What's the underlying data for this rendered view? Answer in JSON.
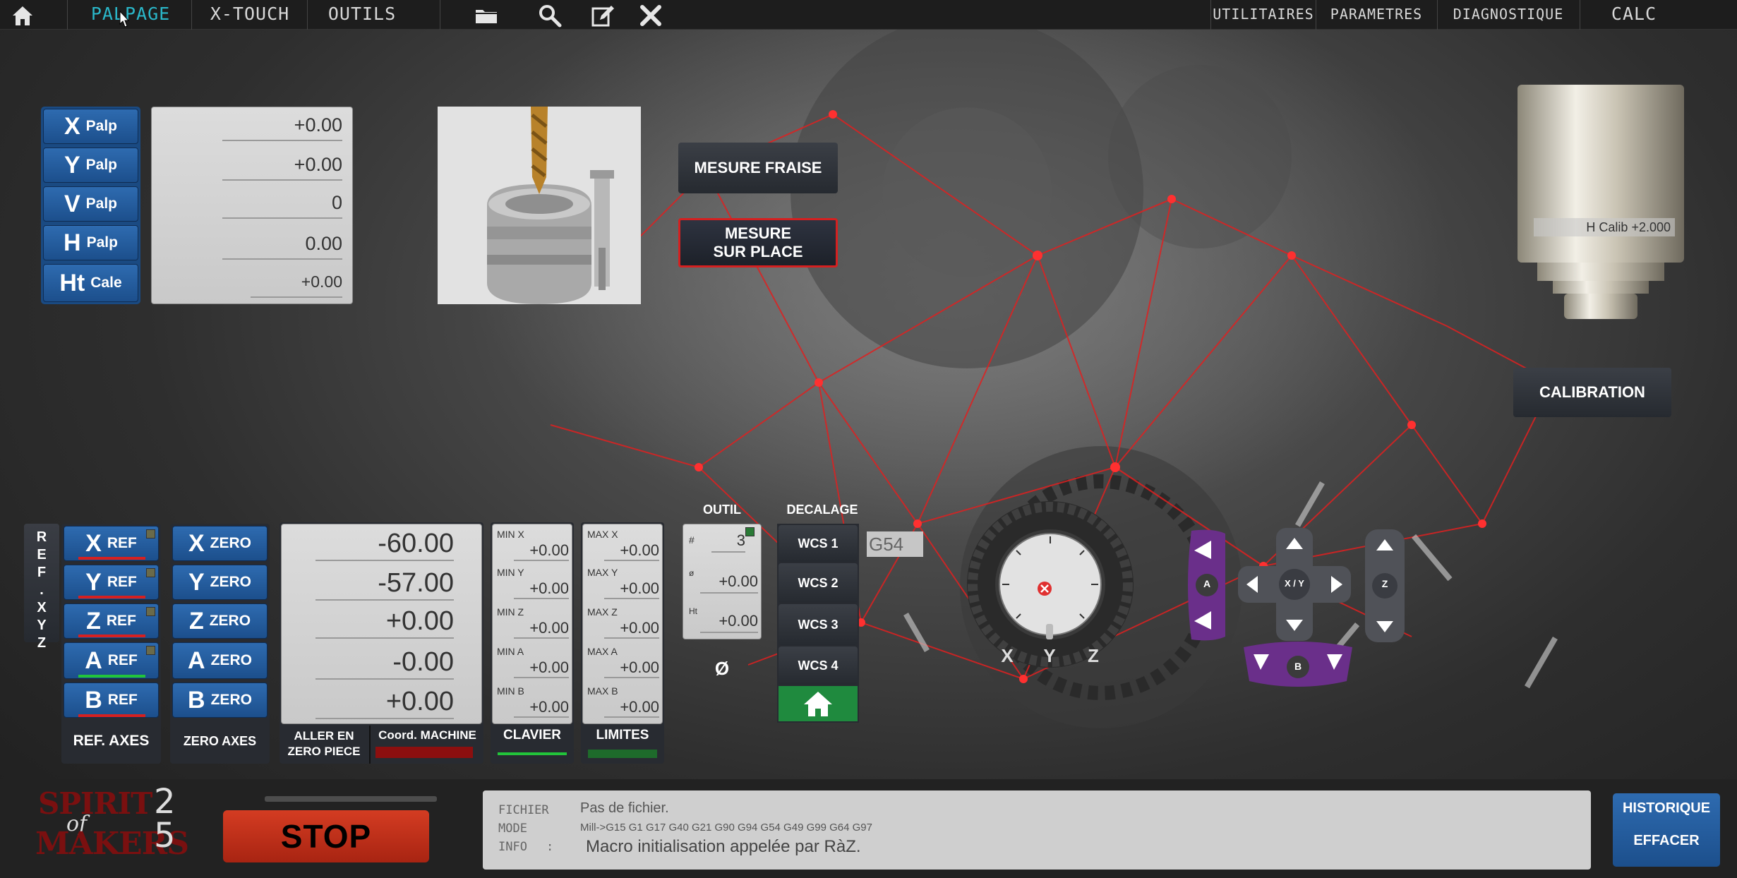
{
  "menu": {
    "tabs": [
      "PALPAGE",
      "X-TOUCH",
      "OUTILS"
    ],
    "right": [
      "UTILITAIRES",
      "PARAMETRES",
      "DIAGNOSTIQUE",
      "CALC"
    ]
  },
  "palp": {
    "rows": [
      {
        "big": "X",
        "small": "Palp",
        "value": "+0.00"
      },
      {
        "big": "Y",
        "small": "Palp",
        "value": "+0.00"
      },
      {
        "big": "V",
        "small": "Palp",
        "value": "0"
      },
      {
        "big": "H",
        "small": "Palp",
        "value": "0.00"
      },
      {
        "big": "Ht",
        "small": "Cale",
        "value": "+0.00"
      }
    ]
  },
  "buttons": {
    "mesure_fraise": "MESURE FRAISE",
    "mesure_sur_place_1": "MESURE",
    "mesure_sur_place_2": "SUR PLACE",
    "calibration": "CALIBRATION",
    "h_calib": "H Calib +2.000"
  },
  "ref": {
    "vertical": "REF.XYZ",
    "axes": [
      {
        "big": "X",
        "ref": "REF",
        "zero": "ZERO",
        "value": "-60.00",
        "min_label": "MIN X",
        "min": "+0.00",
        "max_label": "MAX X",
        "max": "+0.00"
      },
      {
        "big": "Y",
        "ref": "REF",
        "zero": "ZERO",
        "value": "-57.00",
        "min_label": "MIN Y",
        "min": "+0.00",
        "max_label": "MAX Y",
        "max": "+0.00"
      },
      {
        "big": "Z",
        "ref": "REF",
        "zero": "ZERO",
        "value": "+0.00",
        "min_label": "MIN Z",
        "min": "+0.00",
        "max_label": "MAX Z",
        "max": "+0.00"
      },
      {
        "big": "A",
        "ref": "REF",
        "zero": "ZERO",
        "value": "-0.00",
        "min_label": "MIN A",
        "min": "+0.00",
        "max_label": "MAX A",
        "max": "+0.00"
      },
      {
        "big": "B",
        "ref": "REF",
        "zero": "ZERO",
        "value": "+0.00",
        "min_label": "MIN B",
        "min": "+0.00",
        "max_label": "MAX B",
        "max": "+0.00"
      }
    ],
    "ref_axes": "REF. AXES",
    "zero_axes": "ZERO AXES",
    "aller_1": "ALLER EN",
    "aller_2": "ZERO PIECE",
    "coord_machine": "Coord. MACHINE",
    "clavier": "CLAVIER",
    "limites": "LIMITES"
  },
  "outil": {
    "title": "OUTIL",
    "num_label": "#",
    "num": "3",
    "diam_label": "ø",
    "diam": "+0.00",
    "ht_label": "Ht",
    "ht": "+0.00",
    "diam_symbol": "Ø"
  },
  "decalage": {
    "title": "DECALAGE",
    "wcs": [
      "WCS 1",
      "WCS 2",
      "WCS 3",
      "WCS 4"
    ],
    "current": "G54"
  },
  "jog": {
    "labels": [
      "X",
      "Y",
      "Z"
    ],
    "a": "A",
    "xy": "X / Y",
    "z": "Z",
    "b": "B"
  },
  "bottom": {
    "logo_1": "SPIRIT",
    "logo_of": "of",
    "logo_2": "MAKERS",
    "logo_n1": "2",
    "logo_n2": "5",
    "stop": "STOP",
    "fichier_label": "FICHIER",
    "fichier": "Pas de fichier.",
    "mode_label": "MODE",
    "mode": "Mill->G15  G1 G17 G40 G21 G90 G94 G54 G49 G99 G64 G97",
    "info_label": "INFO",
    "info_colon": ":",
    "info": "Macro initialisation appelée par RàZ.",
    "historique": "HISTORIQUE",
    "effacer": "EFFACER"
  },
  "colors": {
    "accent": "#2ab7c9",
    "button_blue": "#2563a8",
    "stop_red": "#c0341d",
    "home_green": "#1f8a3e",
    "jog_purple": "#6a2f8a",
    "network_red": "#e02020"
  },
  "icons": [
    "home-icon",
    "folder-icon",
    "search-icon",
    "edit-icon",
    "close-icon"
  ]
}
